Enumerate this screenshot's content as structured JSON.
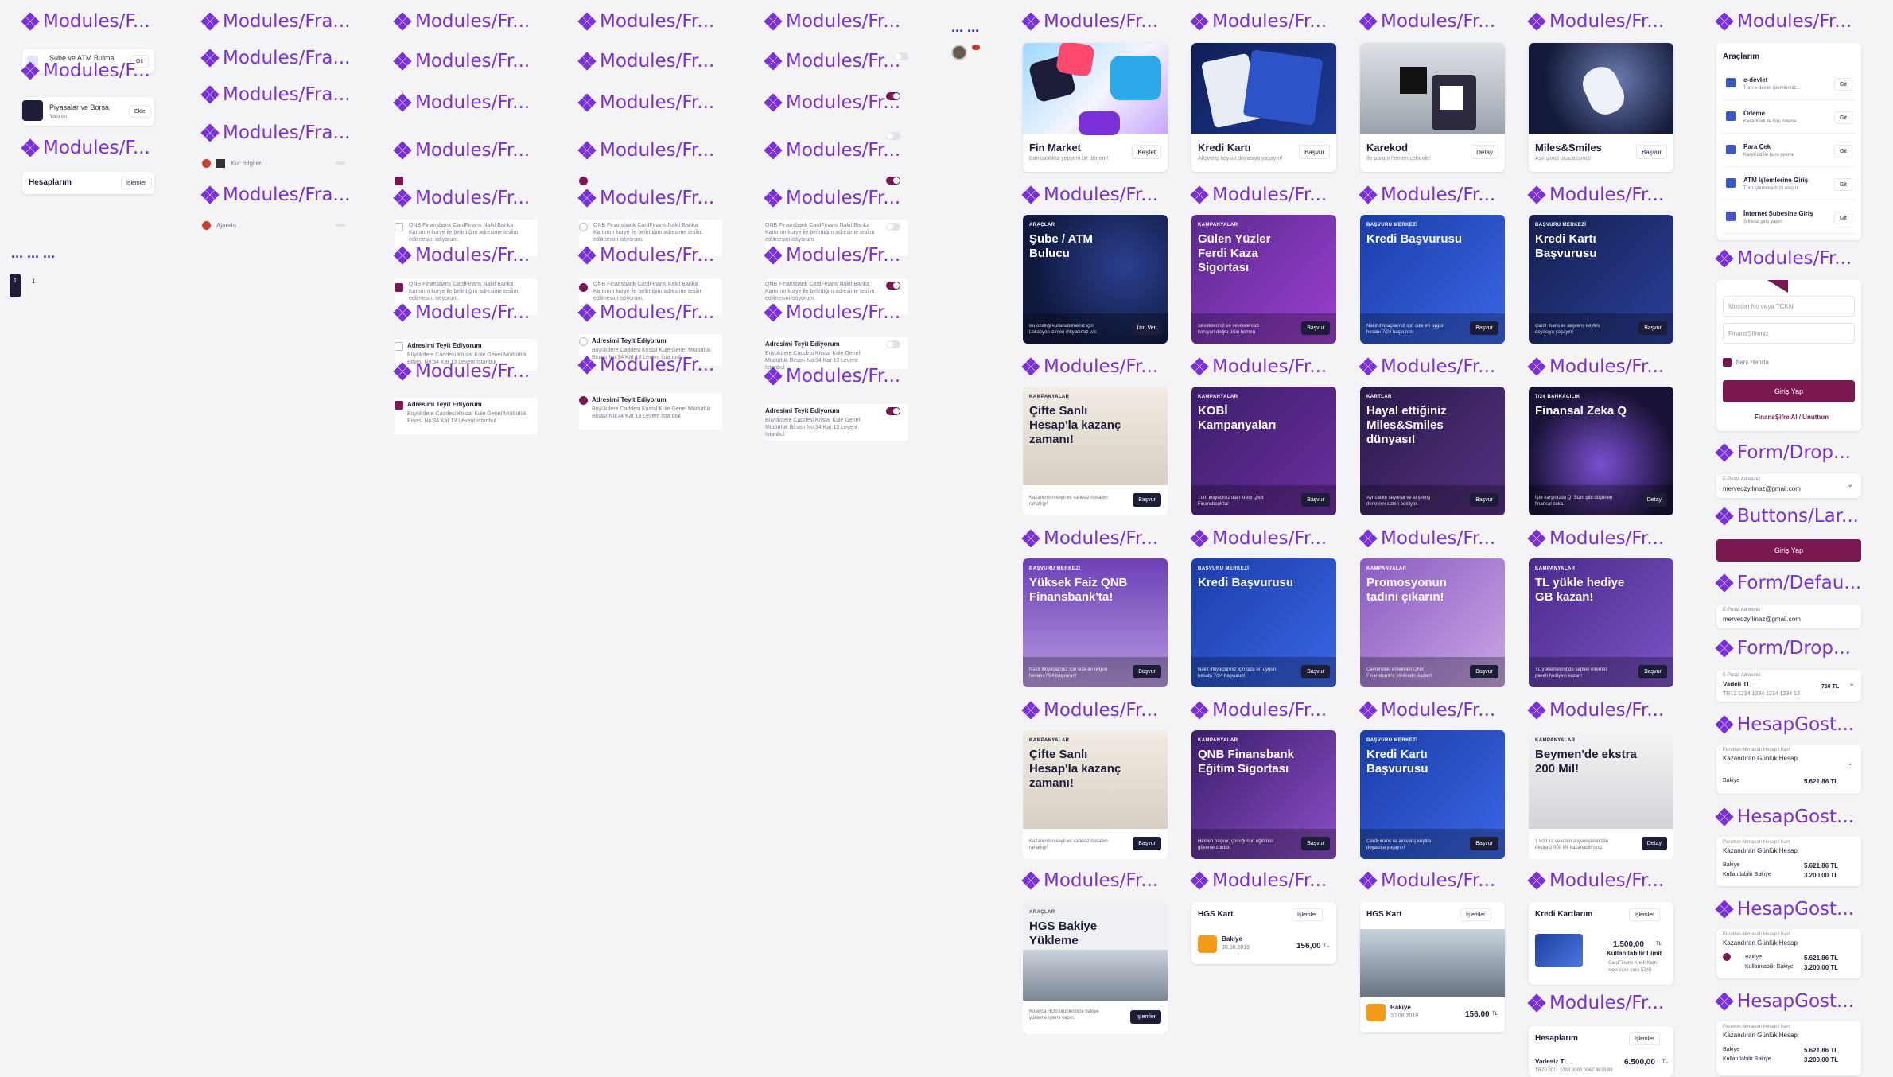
{
  "labels": {
    "module_fr": "Modules/Fr...",
    "module_f": "Modules/F...",
    "module_fra": "Modules/Fra...",
    "form_drop": "Form/Drop...",
    "buttons_lar": "Buttons/Lar...",
    "form_defau": "Form/Defau...",
    "hesap_gost": "HesapGost...",
    "dots": "... ... ...",
    "dots_short": "...  ..."
  },
  "col1": {
    "item1_title": "Şube ve ATM Bulma",
    "item1_btn": "Git",
    "item2_title": "Piyasalar ve Borsa",
    "item2_sub": "Yatırım",
    "item2_btn": "Ekle",
    "hesap_title": "Hesaplarım",
    "hesap_btn": "İşlemler",
    "page1": "1",
    "page2": "1"
  },
  "col2": {
    "kur": "Kur Bilgileri",
    "ajanda": "Ajanda"
  },
  "selection": {
    "qnb_short": "QNB Finansbank CardFinans Nakit Banka Kartımın kurye ile belirttiğim adresime teslim edilmesini istiyorum.",
    "address_title": "Adresimi Teyit Ediyorum",
    "address_text": "Büyükdere Caddesi Kristal Kule Genel Müdürlük Binası No:34 Kat 13 Levent İstanbul"
  },
  "products": {
    "fin_title": "Fin Market",
    "fin_sub": "Bankacılıkta yepyeni bir dönem!",
    "fin_btn": "Keşfet",
    "kredi_title": "Kredi Kartı",
    "kredi_sub": "Alışveriş keyfini doyasıya yaşayın!",
    "kredi_btn": "Başvur",
    "karekod_title": "Karekod",
    "karekod_sub": "İle paranı hemen cebinde!",
    "karekod_btn": "Detay",
    "miles_title": "Miles&Smiles",
    "miles_sub": "Asıl şimdi uçacaksınız!",
    "miles_btn": "Başvur"
  },
  "promos": [
    {
      "cat": "ARAÇLAR",
      "title": "Şube / ATM Bulucu",
      "foot": "Bu özelliği kullanabilmeniz için Lokasyon izinleri ihtiyacımız var.",
      "btn": "İzin Ver"
    },
    {
      "cat": "KAMPANYALAR",
      "title": "Gülen Yüzler Ferdi Kaza Sigortası",
      "foot": "Sevdikleriniz ve sevdiklerinizi koruyan doğru ürün hemen.",
      "btn": "Başvur"
    },
    {
      "cat": "BAŞVURU MERKEZİ",
      "title": "Kredi Başvurusu",
      "foot": "Nakit ihtiyaçlarınız için size en uygun hesabı 7/24 başvurun!",
      "btn": "Başvur"
    },
    {
      "cat": "BAŞVURU MERKEZİ",
      "title": "Kredi Kartı Başvurusu",
      "foot": "CardFinans ile alışveriş keyfini doyasıya yaşayın!",
      "btn": "Başvur"
    },
    {
      "cat": "KAMPANYALAR",
      "title": "Çifte Sanlı Hesap'la kazanç zamanı!",
      "foot": "Kazancımın keyfi ve vadesiz hesabın rahatlığı!",
      "btn": "Başvur"
    },
    {
      "cat": "KAMPANYALAR",
      "title": "KOBİ Kampanyaları",
      "foot": "Tüm ihtiyacınız olan kredi QNB Finansbank'ta!",
      "btn": "Başvur"
    },
    {
      "cat": "KARTLAR",
      "title": "Hayal ettiğiniz Miles&Smiles dünyası!",
      "foot": "Ayrıcalıklı seyahat ve alışveriş deneyimi sizleri bekliyor.",
      "btn": "Başvur"
    },
    {
      "cat": "7/24 BANKACILIK",
      "title": "Finansal Zeka Q",
      "foot": "İşte karşınızda Q! Sizin gibi düşünen finansal zeka.",
      "btn": "Detay"
    },
    {
      "cat": "BAŞVURU MERKEZİ",
      "title": "Yüksek Faiz QNB Finansbank'ta!",
      "foot": "Nakit ihtiyaçlarınız için size en uygun hesabı 7/24 başvurun!",
      "btn": "Başvur"
    },
    {
      "cat": "BAŞVURU MERKEZİ",
      "title": "Kredi Başvurusu",
      "foot": "Nakit ihtiyaçlarınız için size en uygun hesabı 7/24 başvurun!",
      "btn": "Başvur"
    },
    {
      "cat": "KAMPANYALAR",
      "title": "Promosyonun tadını çıkarın!",
      "foot": "Çevrendeki emeklileri QNB Finansbank'a yönlendir, kazan!",
      "btn": "Başvur"
    },
    {
      "cat": "KAMPANYALAR",
      "title": "TL yükle hediye GB kazan!",
      "foot": "TL yüklemelerinde septen internet paketi hediyesi kazan!",
      "btn": "Başvur"
    },
    {
      "cat": "KAMPANYALAR",
      "title": "Çifte Sanlı Hesap'la kazanç zamanı!",
      "foot": "Kazancımın keyfi ve vadesiz hesabın rahatlığı!",
      "btn": "Başvur"
    },
    {
      "cat": "KAMPANYALAR",
      "title": "QNB Finansbank Eğitim Sigortası",
      "foot": "Hemen başvur, çocuğunun eğitimini güvenle sürdür.",
      "btn": "Başvur"
    },
    {
      "cat": "BAŞVURU MERKEZİ",
      "title": "Kredi Kartı Başvurusu",
      "foot": "CardFinans ile alışveriş keyfini doyasıya yaşayın!",
      "btn": "Başvur"
    },
    {
      "cat": "KAMPANYALAR",
      "title": "Beymen'de ekstra 200 Mil!",
      "foot": "1.500 TL ve üzeri alışverişlerinizde ekstra 2.000 Mil kazanabilirsiniz.",
      "btn": "Detay"
    }
  ],
  "hgs": {
    "title": "HGS Bakiye Yükleme",
    "cat": "ARAÇLAR",
    "foot": "Kolayca HGS ürünlerinize bakiye yükleme işlemi yapın.",
    "btn": "İşlemler",
    "kart": "HGS Kart",
    "kart_btn": "İşlemler",
    "bakiye": "Bakiye",
    "date": "30.06.2019",
    "amount": "156,00",
    "cur": "TL"
  },
  "kredi_kartlarim": {
    "title": "Kredi Kartlarım",
    "btn": "İşlemler",
    "amount": "1.500,00",
    "cur": "TL",
    "limit": "Kullanılabilir Limit",
    "card": "CardFinans Kredi Kartı",
    "mask": "xxxx xxxx xxxx 5248"
  },
  "hesaplarim": {
    "title": "Hesaplarım",
    "btn": "İşlemler",
    "acc": "Vadesiz TL",
    "amount": "6.500,00",
    "cur": "TL",
    "iban": "TR70 0011 1000 0000 0067 4679 89"
  },
  "araclarim": {
    "title": "Araçlarım",
    "items": [
      {
        "t": "e-devlet",
        "s": "Tüm e-devlet işlemleriniz...",
        "b": "Git"
      },
      {
        "t": "Ödeme",
        "s": "Kasa Kodi ile tüm ödeme...",
        "b": "Git"
      },
      {
        "t": "Para Çek",
        "s": "KareKod ile para çekme",
        "b": "Git"
      },
      {
        "t": "ATM İşlemlerine Giriş",
        "s": "Tüm işlemlere hızlı ulaşın",
        "b": "Git"
      },
      {
        "t": "İnternet Şubesine Giriş",
        "s": "Şifresiz giriş yapın",
        "b": "Git"
      }
    ]
  },
  "login": {
    "tckn_placeholder": "Müşteri No veya TCKN",
    "pass_placeholder": "FinansŞifreniz",
    "remember": "Beni Hatırla",
    "submit": "Giriş Yap",
    "forgot": "FinansŞifre Al / Unuttum"
  },
  "email": {
    "label": "E-Posta Adresiniz",
    "value": "merveozyilmaz@gmail.com",
    "label2": "E-Posta Adresiniz",
    "value2": "merveozyilmaz@gmail.com"
  },
  "big_button": "Giriş Yap",
  "vadeli": {
    "label": "E-Posta Adresiniz",
    "title": "Vadeli TL",
    "iban": "TR12 1234 1234 1234 1234 12",
    "amount": "750 TL"
  },
  "hesapgost": [
    {
      "l1": "Paramın Akmasıdı Hesap / Kart",
      "l2": "Kazandıran Günlük Hesap",
      "r1": "Bakiye",
      "v1": "5.621,86 TL"
    },
    {
      "l1": "Paramın Akmasıdı Hesap / Kart",
      "l2": "Kazandıran Günlük Hesap",
      "r1": "Bakiye",
      "v1": "5.621,86 TL",
      "r2": "Kullanılabilir Bakiye",
      "v2": "3.200,00 TL"
    },
    {
      "l1": "Paramın Akmasıdı Hesap / Kart",
      "l2": "Kazandıran Günlük Hesap",
      "r1": "Bakiye",
      "v1": "5.621,86 TL",
      "r2": "Kullanılabilir Bakiye",
      "v2": "3.200,00 TL"
    },
    {
      "l1": "Paramın Akmasıdı Hesap / Kart",
      "l2": "Kazandıran Günlük Hesap",
      "r1": "Bakiye",
      "v1": "5.621,86 TL",
      "r2": "Kullanılabilir Bakiye",
      "v2": "3.200,00 TL"
    }
  ],
  "colors": {
    "accent": "#7b2fd6",
    "brand": "#7b1750",
    "navy": "#1d1d3a"
  }
}
